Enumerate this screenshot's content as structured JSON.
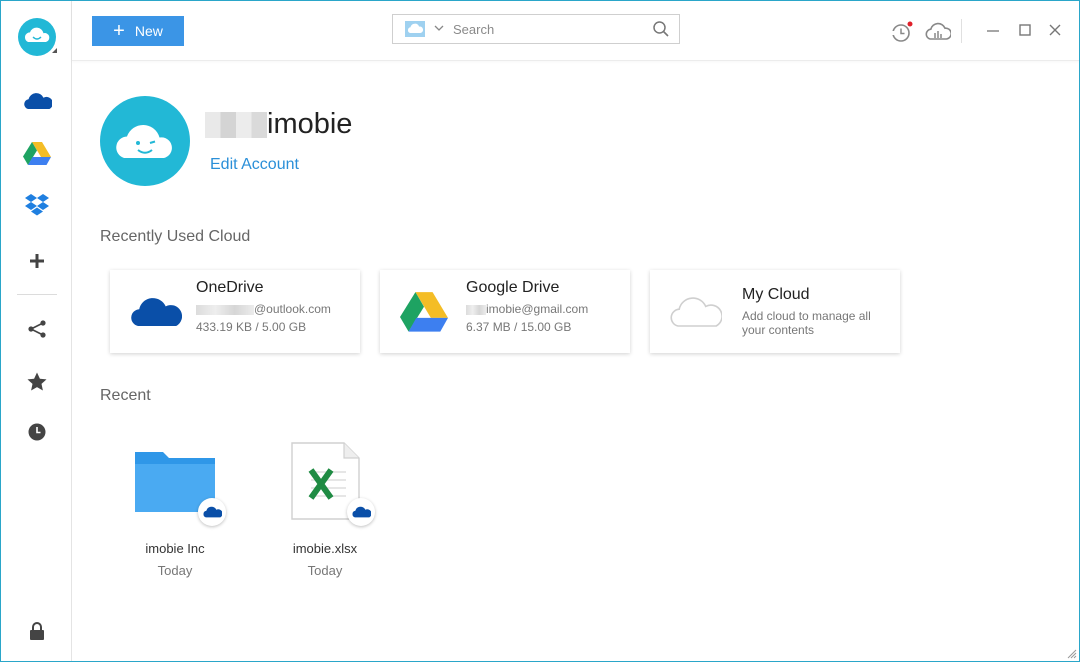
{
  "toolbar": {
    "new_label": "New",
    "search_placeholder": "Search"
  },
  "sidebar": {
    "items": [
      {
        "name": "onedrive",
        "icon": "onedrive-icon"
      },
      {
        "name": "google-drive",
        "icon": "google-drive-icon"
      },
      {
        "name": "dropbox",
        "icon": "dropbox-icon"
      },
      {
        "name": "add-cloud",
        "icon": "plus-icon"
      },
      {
        "name": "share",
        "icon": "share-icon"
      },
      {
        "name": "favorites",
        "icon": "star-icon"
      },
      {
        "name": "recent",
        "icon": "clock-icon"
      },
      {
        "name": "lock",
        "icon": "lock-icon"
      }
    ]
  },
  "account": {
    "name_suffix": "imobie",
    "edit_label": "Edit Account"
  },
  "recently_used_title": "Recently Used Cloud",
  "clouds": [
    {
      "name": "OneDrive",
      "email_suffix": "@outlook.com",
      "usage": "433.19 KB / 5.00 GB"
    },
    {
      "name": "Google Drive",
      "email_suffix": "imobie@gmail.com",
      "usage": "6.37 MB / 15.00 GB"
    },
    {
      "name": "My Cloud",
      "desc": "Add cloud to manage all your contents"
    }
  ],
  "recent_title": "Recent",
  "recent_files": [
    {
      "name": "imobie Inc",
      "date": "Today",
      "type": "folder"
    },
    {
      "name": "imobie.xlsx",
      "date": "Today",
      "type": "excel"
    }
  ],
  "colors": {
    "accent": "#3b95e6",
    "brand_cyan": "#22b8d6",
    "link": "#2a8fd8",
    "onedrive_blue": "#0a4fa8",
    "notification_red": "#e0202a"
  }
}
